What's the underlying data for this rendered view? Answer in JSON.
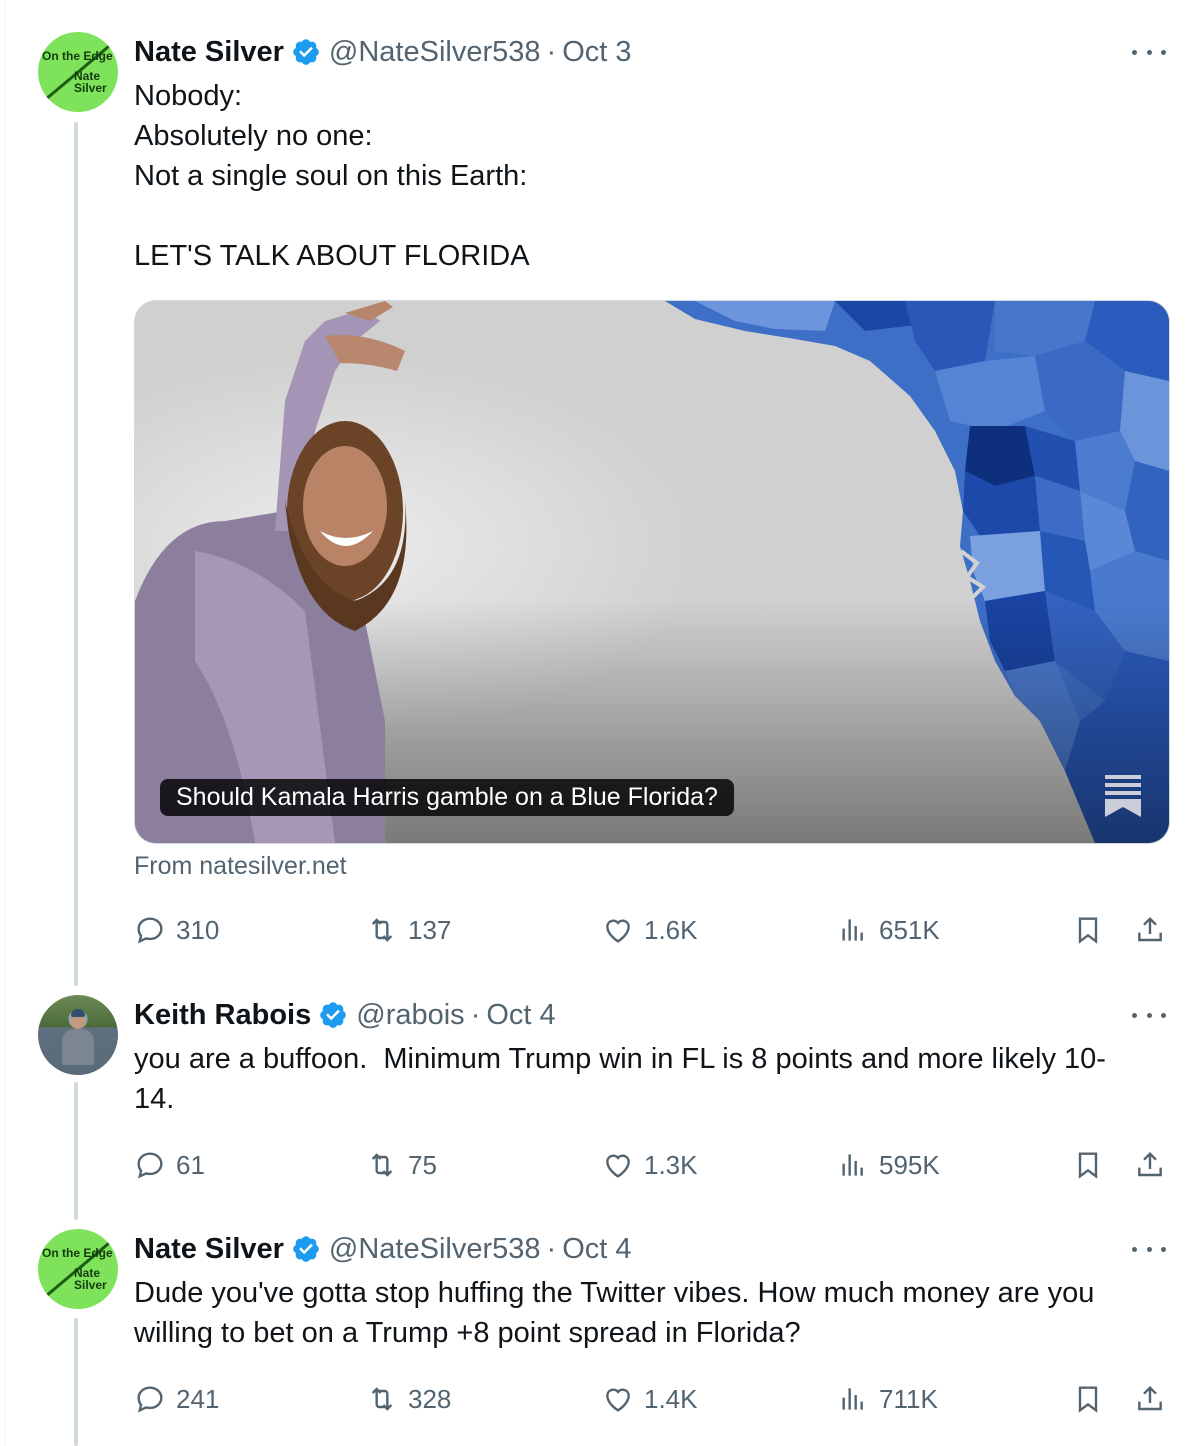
{
  "tweets": [
    {
      "author_name": "Nate Silver",
      "handle": "@NateSilver538",
      "separator": "·",
      "date": "Oct 3",
      "avatar_text_top": "On the Edge",
      "avatar_text_bottom": "Nate Silver",
      "text": "Nobody:\nAbsolutely no one:\nNot a single soul on this Earth:\n\nLET'S TALK ABOUT FLORIDA",
      "card": {
        "title": "Should Kamala Harris gamble on a Blue Florida?",
        "source": "From natesilver.net"
      },
      "replies": "310",
      "reposts": "137",
      "likes": "1.6K",
      "views": "651K"
    },
    {
      "author_name": "Keith Rabois",
      "handle": "@rabois",
      "separator": "·",
      "date": "Oct 4",
      "text": "you are a buffoon.  Minimum Trump win in FL is 8 points and more likely 10-\n14.",
      "replies": "61",
      "reposts": "75",
      "likes": "1.3K",
      "views": "595K"
    },
    {
      "author_name": "Nate Silver",
      "handle": "@NateSilver538",
      "separator": "·",
      "date": "Oct 4",
      "avatar_text_top": "On the Edge",
      "avatar_text_bottom": "Nate Silver",
      "text": "Dude you've gotta stop huffing the Twitter vibes. How much money are you\nwilling to bet on a Trump +8 point spread in Florida?",
      "replies": "241",
      "reposts": "328",
      "likes": "1.4K",
      "views": "711K"
    }
  ],
  "colors": {
    "verified_blue": "#1d9bf0",
    "avatar_green": "#7ee35a",
    "muted_text": "#536471",
    "thread_line": "#cfd9de"
  },
  "icons": [
    "verified-badge-icon",
    "more-icon",
    "reply-icon",
    "repost-icon",
    "like-icon",
    "views-icon",
    "bookmark-icon",
    "share-icon",
    "article-icon"
  ]
}
